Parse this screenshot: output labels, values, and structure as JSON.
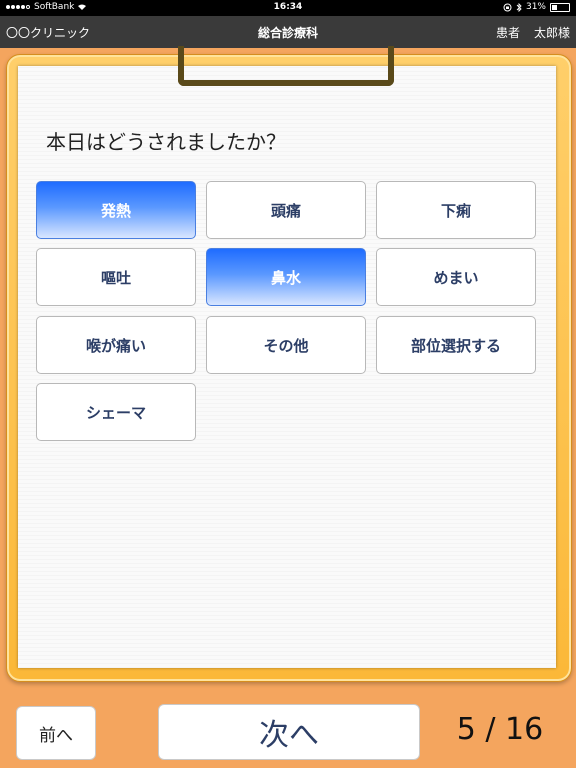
{
  "status_bar": {
    "carrier": "SoftBank",
    "time": "16:34",
    "battery_percent": "31%",
    "battery_level": 0.31,
    "icons": [
      "signal-dots-icon",
      "wifi-icon",
      "lock-rotation-icon",
      "bluetooth-icon",
      "battery-icon"
    ]
  },
  "nav": {
    "clinic": "〇〇クリニック",
    "department": "総合診療科",
    "patient_label": "患者",
    "patient_name": "太郎様"
  },
  "question": "本日はどうされましたか？",
  "choices": [
    {
      "label": "発熱",
      "selected": true
    },
    {
      "label": "頭痛",
      "selected": false
    },
    {
      "label": "下痢",
      "selected": false
    },
    {
      "label": "嘔吐",
      "selected": false
    },
    {
      "label": "鼻水",
      "selected": true
    },
    {
      "label": "めまい",
      "selected": false
    },
    {
      "label": "喉が痛い",
      "selected": false
    },
    {
      "label": "その他",
      "selected": false
    },
    {
      "label": "部位選択する",
      "selected": false
    },
    {
      "label": "シェーマ",
      "selected": false
    }
  ],
  "footer": {
    "prev_label": "前へ",
    "next_label": "次へ",
    "page": "5 / 16"
  },
  "colors": {
    "selected_top": "#1f6cff",
    "frame": "#fbb838",
    "background": "#f4a55e",
    "text_accent": "#2c3e66"
  }
}
